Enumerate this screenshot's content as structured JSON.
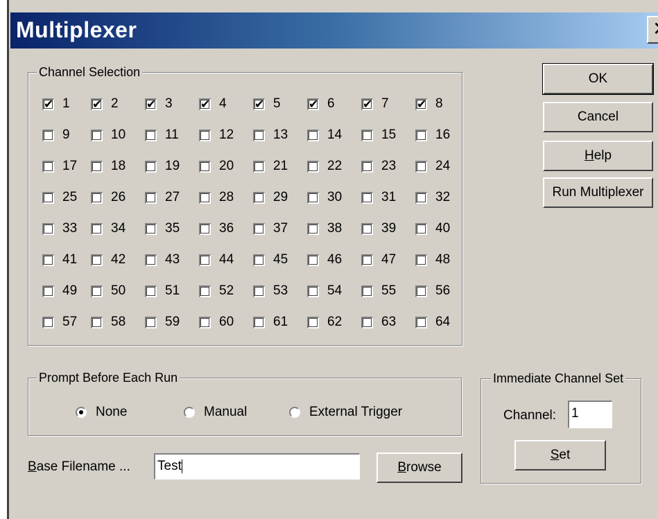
{
  "window": {
    "title": "Multiplexer",
    "close_label": "✕"
  },
  "channel_selection": {
    "label": "Channel Selection",
    "channels": [
      {
        "n": "1",
        "checked": true
      },
      {
        "n": "2",
        "checked": true
      },
      {
        "n": "3",
        "checked": true
      },
      {
        "n": "4",
        "checked": true
      },
      {
        "n": "5",
        "checked": true
      },
      {
        "n": "6",
        "checked": true
      },
      {
        "n": "7",
        "checked": true
      },
      {
        "n": "8",
        "checked": true
      },
      {
        "n": "9",
        "checked": false
      },
      {
        "n": "10",
        "checked": false
      },
      {
        "n": "11",
        "checked": false
      },
      {
        "n": "12",
        "checked": false
      },
      {
        "n": "13",
        "checked": false
      },
      {
        "n": "14",
        "checked": false
      },
      {
        "n": "15",
        "checked": false
      },
      {
        "n": "16",
        "checked": false
      },
      {
        "n": "17",
        "checked": false
      },
      {
        "n": "18",
        "checked": false
      },
      {
        "n": "19",
        "checked": false
      },
      {
        "n": "20",
        "checked": false
      },
      {
        "n": "21",
        "checked": false
      },
      {
        "n": "22",
        "checked": false
      },
      {
        "n": "23",
        "checked": false
      },
      {
        "n": "24",
        "checked": false
      },
      {
        "n": "25",
        "checked": false
      },
      {
        "n": "26",
        "checked": false
      },
      {
        "n": "27",
        "checked": false
      },
      {
        "n": "28",
        "checked": false
      },
      {
        "n": "29",
        "checked": false
      },
      {
        "n": "30",
        "checked": false
      },
      {
        "n": "31",
        "checked": false
      },
      {
        "n": "32",
        "checked": false
      },
      {
        "n": "33",
        "checked": false
      },
      {
        "n": "34",
        "checked": false
      },
      {
        "n": "35",
        "checked": false
      },
      {
        "n": "36",
        "checked": false
      },
      {
        "n": "37",
        "checked": false
      },
      {
        "n": "38",
        "checked": false
      },
      {
        "n": "39",
        "checked": false
      },
      {
        "n": "40",
        "checked": false
      },
      {
        "n": "41",
        "checked": false
      },
      {
        "n": "42",
        "checked": false
      },
      {
        "n": "43",
        "checked": false
      },
      {
        "n": "44",
        "checked": false
      },
      {
        "n": "45",
        "checked": false
      },
      {
        "n": "46",
        "checked": false
      },
      {
        "n": "47",
        "checked": false
      },
      {
        "n": "48",
        "checked": false
      },
      {
        "n": "49",
        "checked": false
      },
      {
        "n": "50",
        "checked": false
      },
      {
        "n": "51",
        "checked": false
      },
      {
        "n": "52",
        "checked": false
      },
      {
        "n": "53",
        "checked": false
      },
      {
        "n": "54",
        "checked": false
      },
      {
        "n": "55",
        "checked": false
      },
      {
        "n": "56",
        "checked": false
      },
      {
        "n": "57",
        "checked": false
      },
      {
        "n": "58",
        "checked": false
      },
      {
        "n": "59",
        "checked": false
      },
      {
        "n": "60",
        "checked": false
      },
      {
        "n": "61",
        "checked": false
      },
      {
        "n": "62",
        "checked": false
      },
      {
        "n": "63",
        "checked": false
      },
      {
        "n": "64",
        "checked": false
      }
    ]
  },
  "prompt_before_each_run": {
    "label": "Prompt Before Each Run",
    "options": [
      {
        "label": "None",
        "selected": true
      },
      {
        "label": "Manual",
        "selected": false
      },
      {
        "label": "External Trigger",
        "selected": false
      }
    ]
  },
  "base_filename": {
    "label_underlined": "B",
    "label_rest": "ase Filename ...",
    "value": "Test"
  },
  "browse": {
    "underlined": "B",
    "rest": "rowse"
  },
  "buttons": {
    "ok": "OK",
    "cancel": "Cancel",
    "help_underlined": "H",
    "help_rest": "elp",
    "run": "Run Multiplexer"
  },
  "immediate_channel_set": {
    "label": "Immediate Channel Set",
    "channel_label": "Channel:",
    "channel_value": "1",
    "set_underlined": "S",
    "set_rest": "et"
  }
}
